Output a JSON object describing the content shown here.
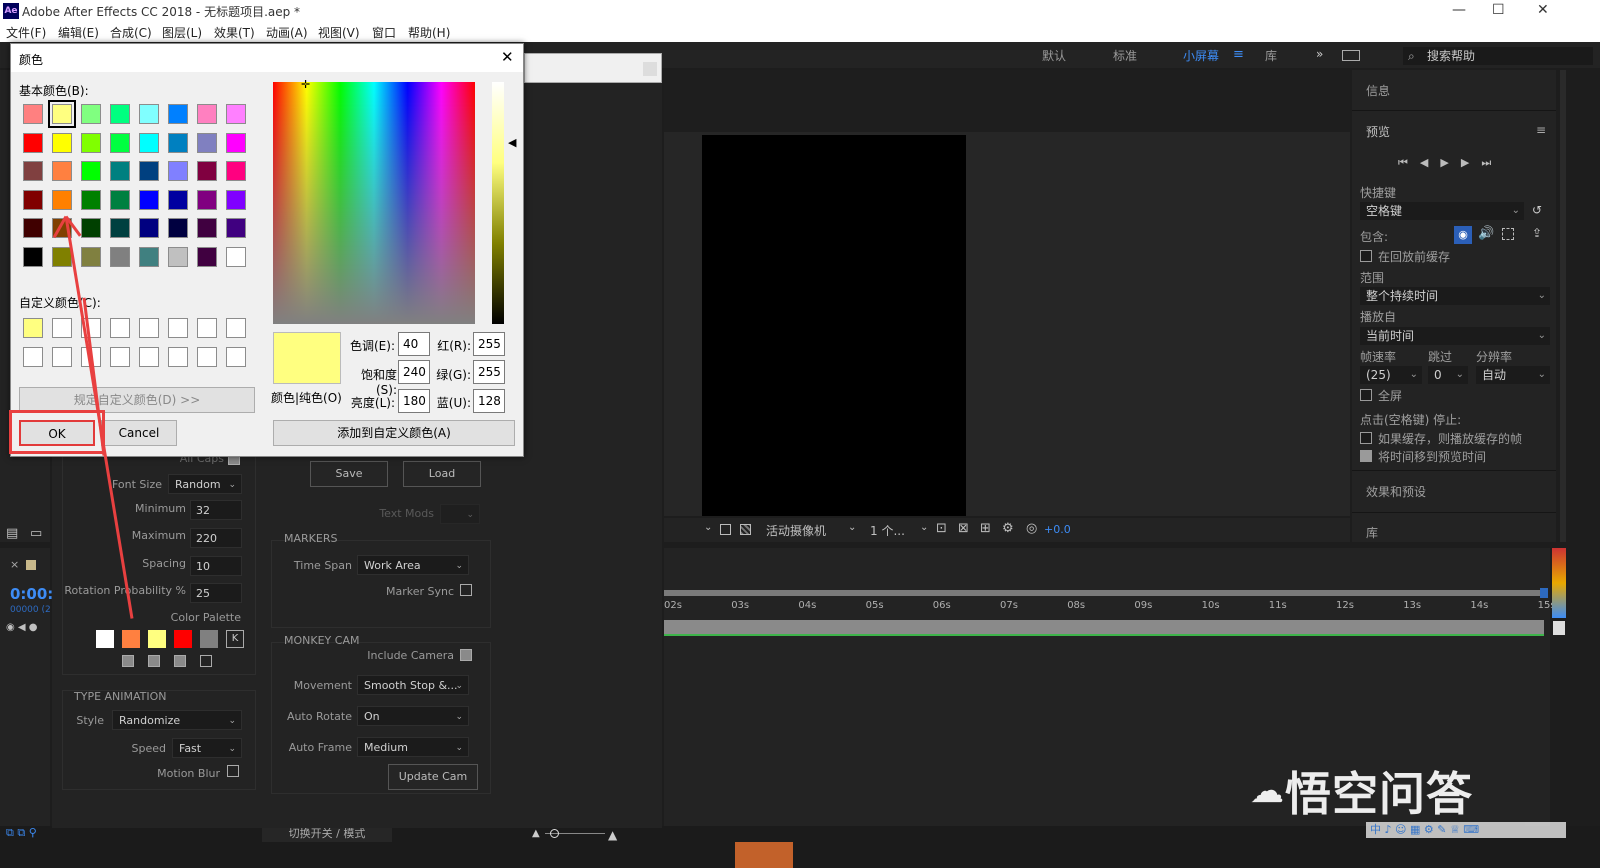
{
  "app": {
    "title": "Adobe After Effects CC 2018 - 无标题项目.aep *",
    "logo": "Ae"
  },
  "window_controls": {
    "minimize": "—",
    "maximize": "☐",
    "close": "✕"
  },
  "menu": [
    "文件(F)",
    "编辑(E)",
    "合成(C)",
    "图层(L)",
    "效果(T)",
    "动画(A)",
    "视图(V)",
    "窗口",
    "帮助(H)"
  ],
  "workspaces": {
    "items": [
      "默认",
      "标准",
      "小屏幕",
      "库"
    ],
    "active": "小屏幕",
    "more": "»"
  },
  "search": {
    "placeholder": "搜索帮助"
  },
  "right_panel": {
    "info": "信息",
    "preview": "预览",
    "shortcut_label": "快捷键",
    "shortcut_value": "空格键",
    "include_label": "包含:",
    "cache_before": "在回放前缓存",
    "range_label": "范围",
    "range_value": "整个持续时间",
    "play_from_label": "播放自",
    "play_from_value": "当前时间",
    "fps_label": "帧速率",
    "skip_label": "跳过",
    "res_label": "分辨率",
    "fps_value": "(25)",
    "skip_value": "0",
    "res_value": "自动",
    "fullscreen": "全屏",
    "stop_label": "点击(空格键) 停止:",
    "opt1": "如果缓存，则播放缓存的帧",
    "opt2": "将时间移到预览时间",
    "effects": "效果和预设",
    "library": "库"
  },
  "viewer_bar": {
    "camera": "活动摄像机",
    "views": "1 个...",
    "exposure": "+0.0"
  },
  "timeline": {
    "ticks": [
      "02s",
      "03s",
      "04s",
      "05s",
      "06s",
      "07s",
      "08s",
      "09s",
      "10s",
      "11s",
      "12s",
      "13s",
      "14s",
      "15s"
    ],
    "timecode": "0:00:",
    "frames": "00000 (2",
    "toggle_label": "切换开关 / 模式"
  },
  "plugin": {
    "all_caps": "All Caps",
    "font_size_label": "Font Size",
    "font_size_value": "Random",
    "minimum_label": "Minimum",
    "minimum_value": "32",
    "maximum_label": "Maximum",
    "maximum_value": "220",
    "spacing_label": "Spacing",
    "spacing_value": "10",
    "rotation_label": "Rotation Probability %",
    "rotation_value": "25",
    "palette_label": "Color Palette",
    "palette_colors": [
      "#ffffff",
      "#ff8040",
      "#ffff80",
      "#ff0000",
      "#808080"
    ],
    "palette_k": "K",
    "palette_checks": [
      true,
      true,
      true,
      false
    ],
    "type_anim_title": "TYPE ANIMATION",
    "style_label": "Style",
    "style_value": "Randomize",
    "speed_label": "Speed",
    "speed_value": "Fast",
    "motion_blur_label": "Motion Blur",
    "save_btn": "Save",
    "load_btn": "Load",
    "text_mods": "Text Mods",
    "markers_title": "MARKERS",
    "time_span_label": "Time Span",
    "time_span_value": "Work Area",
    "marker_sync_label": "Marker Sync",
    "monkey_title": "MONKEY CAM",
    "include_camera_label": "Include Camera",
    "movement_label": "Movement",
    "movement_value": "Smooth Stop &...",
    "auto_rotate_label": "Auto Rotate",
    "auto_rotate_value": "On",
    "auto_frame_label": "Auto Frame",
    "auto_frame_value": "Medium",
    "update_cam_btn": "Update Cam"
  },
  "color_dialog": {
    "title": "颜色",
    "basic_label": "基本颜色(B):",
    "custom_label": "自定义颜色(C):",
    "define_btn": "规定自定义颜色(D) >>",
    "ok_btn": "OK",
    "cancel_btn": "Cancel",
    "color_solid_label": "颜色|纯色(O)",
    "hue_label": "色调(E):",
    "hue_value": "40",
    "sat_label": "饱和度(S):",
    "sat_value": "240",
    "lum_label": "亮度(L):",
    "lum_value": "180",
    "red_label": "红(R):",
    "red_value": "255",
    "green_label": "绿(G):",
    "green_value": "255",
    "blue_label": "蓝(U):",
    "blue_value": "128",
    "add_custom_btn": "添加到自定义颜色(A)",
    "current_color": "#ffff80",
    "basic_colors": [
      [
        "#ff8080",
        "#ffff80",
        "#80ff80",
        "#00ff80",
        "#80ffff",
        "#0080ff",
        "#ff80c0",
        "#ff80ff"
      ],
      [
        "#ff0000",
        "#ffff00",
        "#80ff00",
        "#00ff40",
        "#00ffff",
        "#0080c0",
        "#8080c0",
        "#ff00ff"
      ],
      [
        "#804040",
        "#ff8040",
        "#00ff00",
        "#008080",
        "#004080",
        "#8080ff",
        "#800040",
        "#ff0080"
      ],
      [
        "#800000",
        "#ff8000",
        "#008000",
        "#008040",
        "#0000ff",
        "#0000a0",
        "#800080",
        "#8000ff"
      ],
      [
        "#400000",
        "#804000",
        "#004000",
        "#004040",
        "#000080",
        "#000040",
        "#400040",
        "#400080"
      ],
      [
        "#000000",
        "#808000",
        "#808040",
        "#808080",
        "#408080",
        "#c0c0c0",
        "#400040",
        "#ffffff"
      ]
    ],
    "selected_index": 1
  },
  "watermark": {
    "text": "悟空问答"
  }
}
